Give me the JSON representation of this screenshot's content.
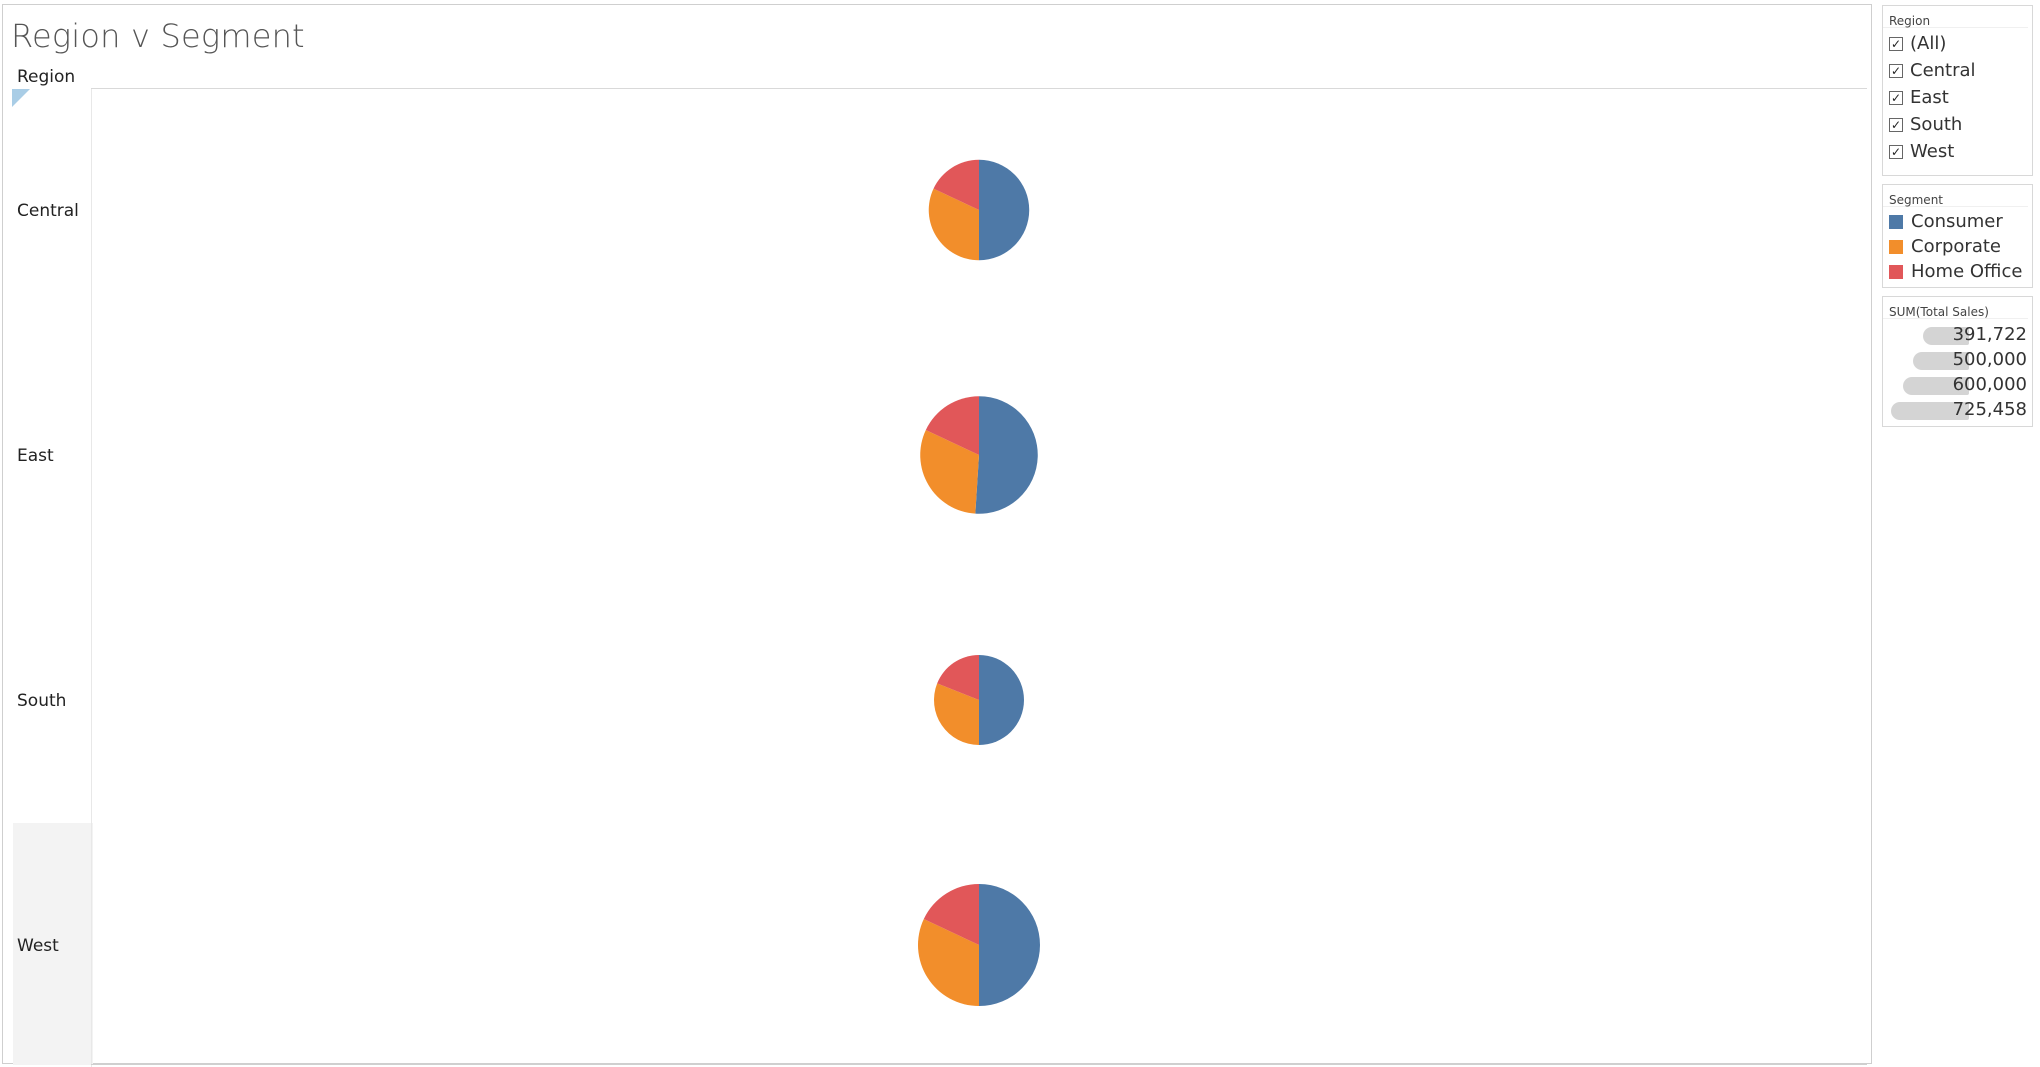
{
  "title": "Region v Segment",
  "row_header": "Region",
  "filter": {
    "title": "Region",
    "items": [
      {
        "label": "(All)",
        "checked": true
      },
      {
        "label": "Central",
        "checked": true
      },
      {
        "label": "East",
        "checked": true
      },
      {
        "label": "South",
        "checked": true
      },
      {
        "label": "West",
        "checked": true
      }
    ]
  },
  "color_legend": {
    "title": "Segment",
    "items": [
      {
        "label": "Consumer",
        "color": "#4e79a7"
      },
      {
        "label": "Corporate",
        "color": "#f28e2b"
      },
      {
        "label": "Home Office",
        "color": "#e15759"
      }
    ]
  },
  "size_legend": {
    "title": "SUM(Total Sales)",
    "items": [
      {
        "label": "391,722",
        "value": 391722
      },
      {
        "label": "500,000",
        "value": 500000
      },
      {
        "label": "600,000",
        "value": 600000
      },
      {
        "label": "725,458",
        "value": 725458
      }
    ]
  },
  "chart_data": {
    "type": "pie",
    "title": "Region v Segment",
    "rows_field": "Region",
    "color_field": "Segment",
    "size_field": "SUM(Total Sales)",
    "segments": [
      "Consumer",
      "Corporate",
      "Home Office"
    ],
    "colors": [
      "#4e79a7",
      "#f28e2b",
      "#e15759"
    ],
    "regions": [
      {
        "name": "Central",
        "total": 501240,
        "shares": [
          0.5,
          0.32,
          0.18
        ]
      },
      {
        "name": "East",
        "total": 678781,
        "shares": [
          0.51,
          0.31,
          0.18
        ]
      },
      {
        "name": "South",
        "total": 391722,
        "shares": [
          0.5,
          0.31,
          0.19
        ]
      },
      {
        "name": "West",
        "total": 725458,
        "shares": [
          0.5,
          0.32,
          0.18
        ]
      }
    ]
  }
}
